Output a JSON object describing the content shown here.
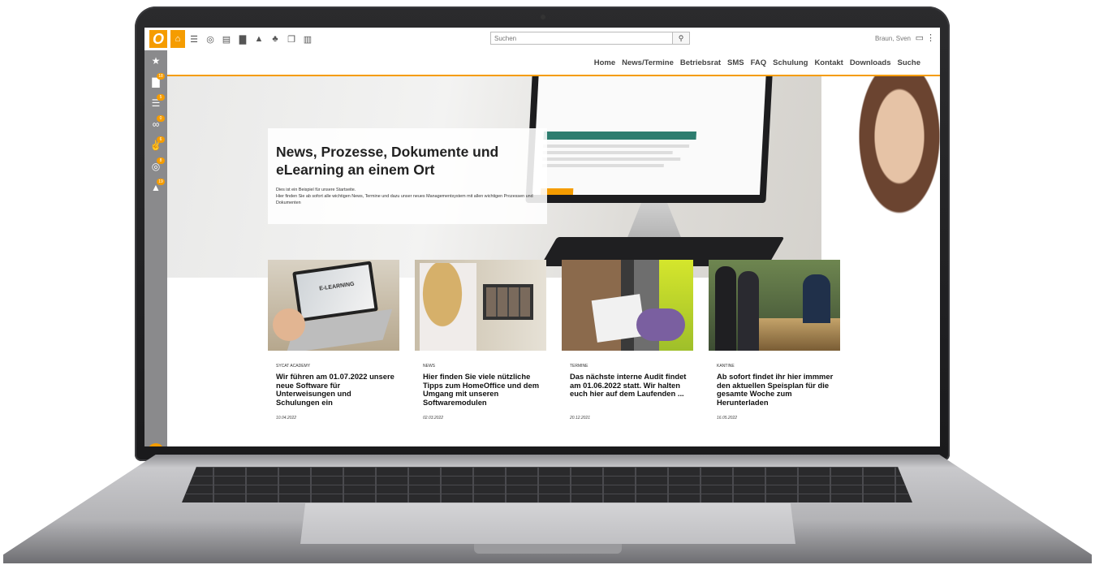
{
  "app": {
    "logo_letter": "O",
    "toolbar_icons": [
      "home-icon",
      "checklist-icon",
      "target-icon",
      "server-icon",
      "document-icon",
      "graduation-icon",
      "org-chart-icon",
      "copy-icon",
      "bar-chart-icon"
    ],
    "search_placeholder": "Suchen",
    "user_name": "Braun, Sven"
  },
  "sidebar": {
    "items": [
      {
        "icon": "star-icon",
        "badge": ""
      },
      {
        "icon": "document-icon",
        "badge": "18"
      },
      {
        "icon": "checklist-icon",
        "badge": "5"
      },
      {
        "icon": "glasses-icon",
        "badge": "0"
      },
      {
        "icon": "thumbs-icon",
        "badge": "6"
      },
      {
        "icon": "target-icon",
        "badge": "8"
      },
      {
        "icon": "graduation-icon",
        "badge": "19"
      }
    ],
    "fab_label": "+"
  },
  "nav": {
    "items": [
      "Home",
      "News/Termine",
      "Betriebsrat",
      "SMS",
      "FAQ",
      "Schulung",
      "Kontakt",
      "Downloads",
      "Suche"
    ]
  },
  "hero": {
    "title": "News, Prozesse, Dokumente und eLearning an einem Ort",
    "line1": "Dies ist ein Beispiel für unsere Startseite.",
    "line2": "Hier finden Sie ab sofort alle wichtigen News, Termine und dazu unser neues Managementsystem mit allen wichtigen Prozessen und Dokumenten"
  },
  "cards": [
    {
      "category": "SYCAT ACADEMY",
      "title": "Wir führen am 01.07.2022 unsere neue Software für Unterweisungen und Schulungen ein",
      "date": "10.04.2022",
      "image_label": "E-LEARNING"
    },
    {
      "category": "NEWS",
      "title": "Hier finden Sie viele nützliche Tipps zum HomeOffice und dem Umgang mit unseren Softwaremodulen",
      "date": "02.03.2022"
    },
    {
      "category": "TERMINE",
      "title": "Das nächste interne Audit findet am 01.06.2022 statt. Wir halten euch hier auf dem Laufenden ...",
      "date": "20.12.2021"
    },
    {
      "category": "KANTINE",
      "title": "Ab sofort findet ihr hier immmer den aktuellen Speisplan für die gesamte Woche zum Herunterladen",
      "date": "16.05.2022"
    }
  ],
  "colors": {
    "accent": "#f59c00",
    "sidebar": "#8a8a8c"
  }
}
